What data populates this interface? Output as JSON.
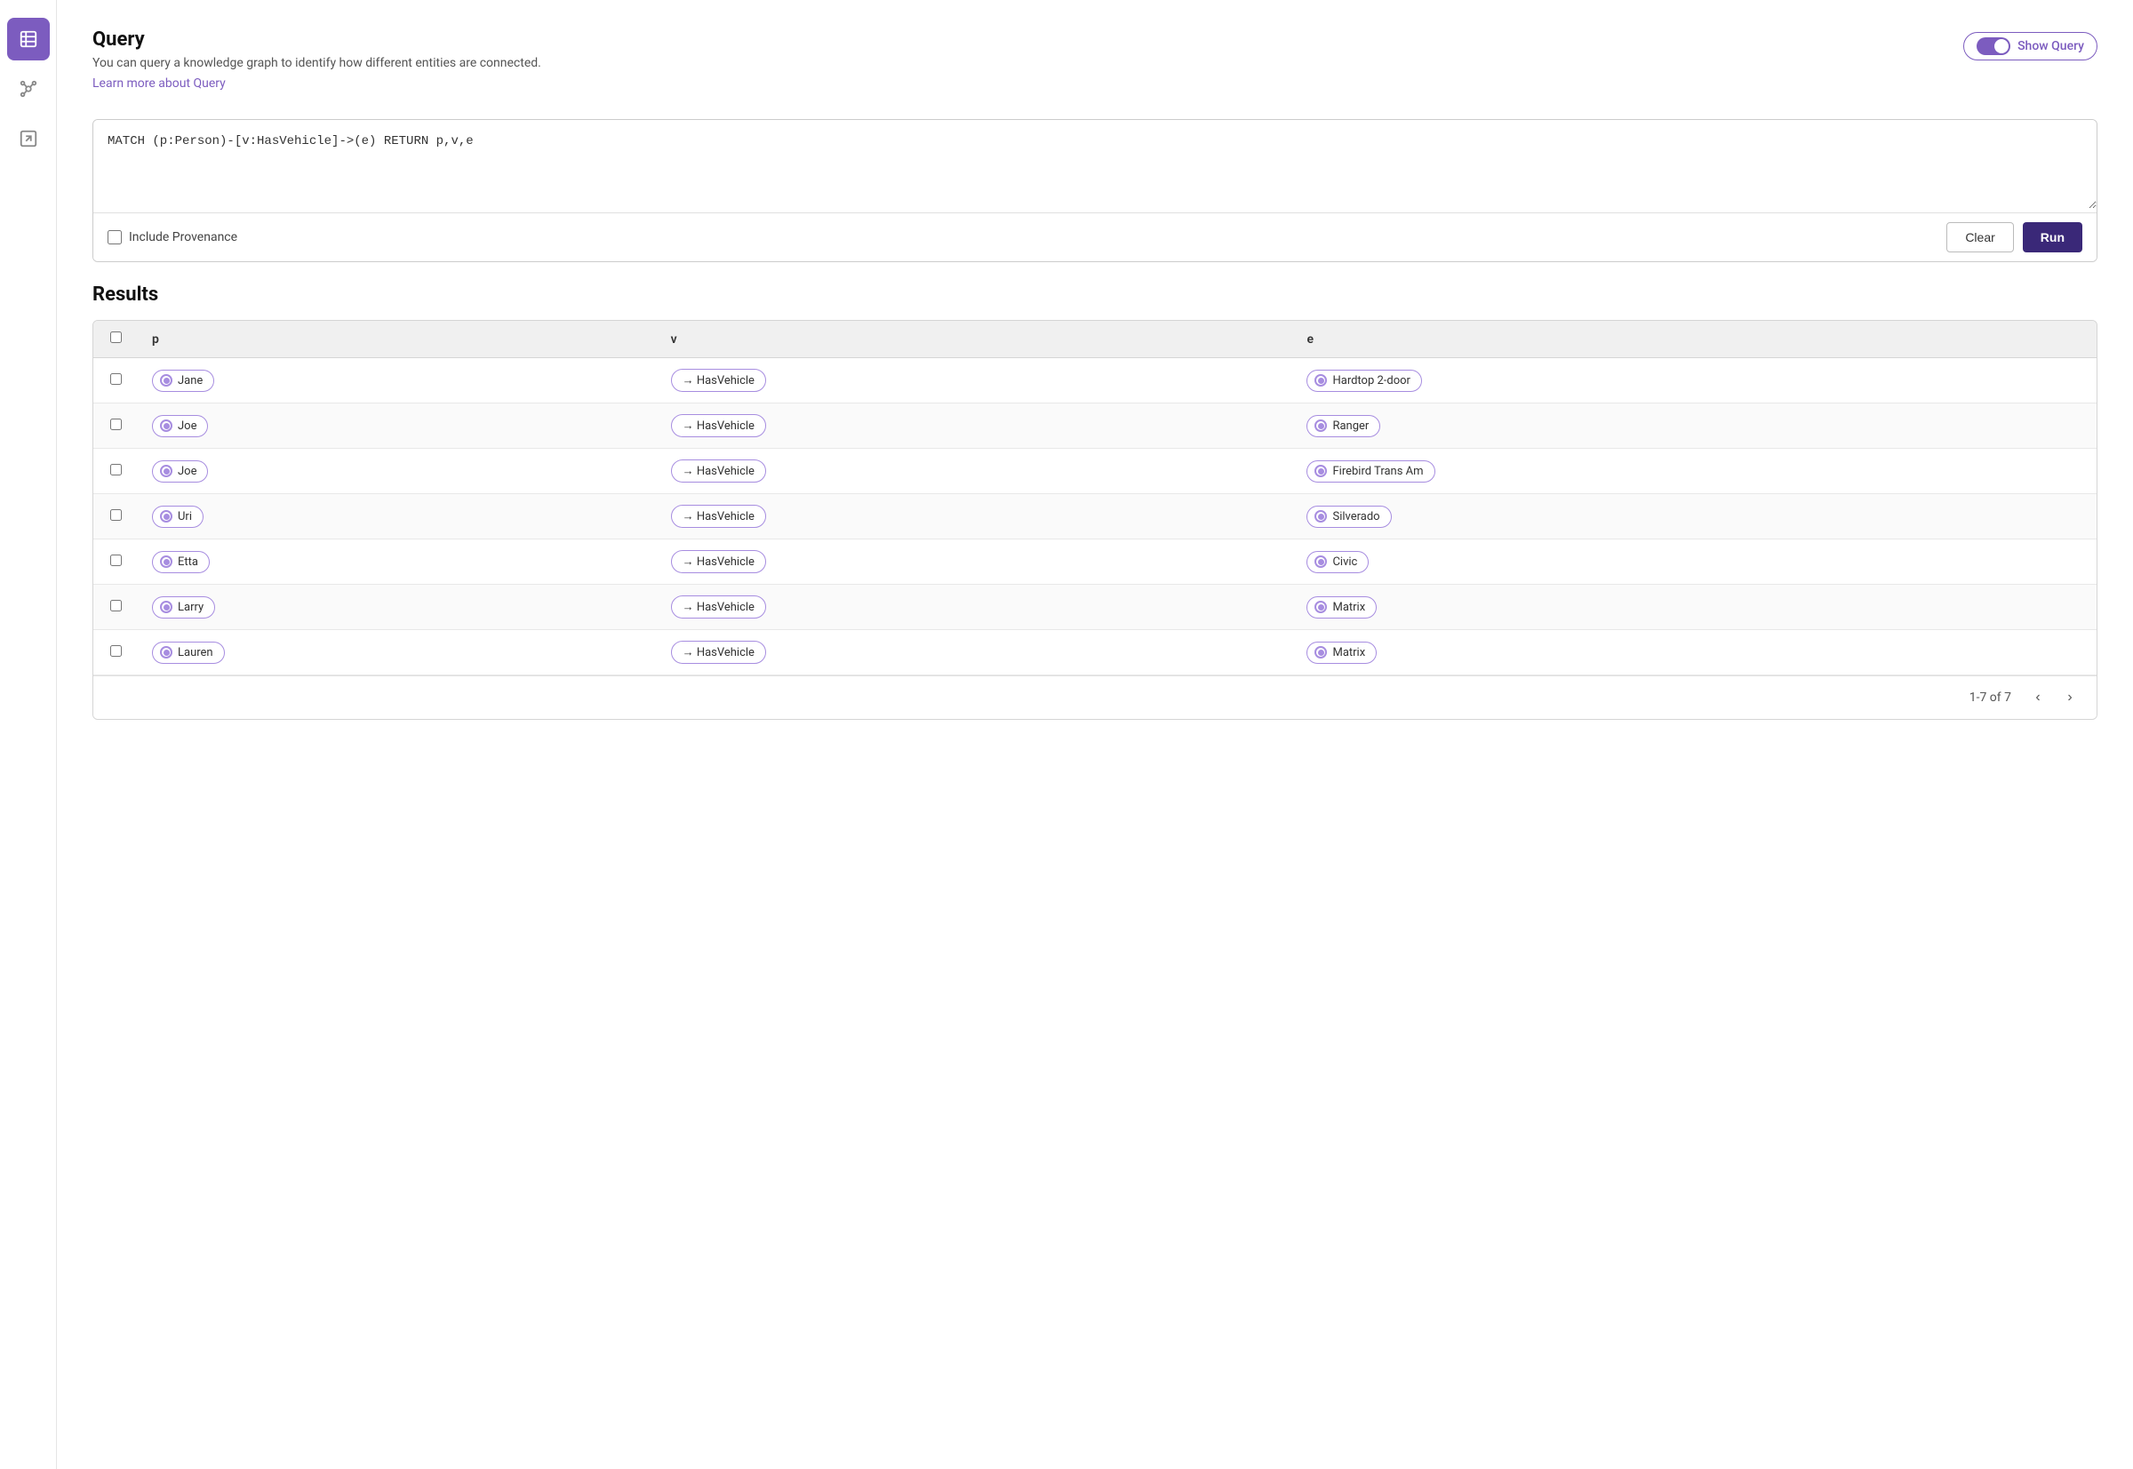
{
  "sidebar": {
    "items": [
      {
        "id": "table",
        "icon": "table-icon",
        "active": true
      },
      {
        "id": "graph",
        "icon": "graph-icon",
        "active": false
      },
      {
        "id": "export",
        "icon": "export-icon",
        "active": false
      }
    ]
  },
  "query": {
    "title": "Query",
    "description": "You can query a knowledge graph to identify how different entities are connected.",
    "learn_more_text": "Learn more about Query",
    "toggle_label": "Show Query",
    "query_text": "MATCH (p:Person)-[v:HasVehicle]->(e) RETURN p,v,e",
    "include_provenance_label": "Include Provenance",
    "clear_button": "Clear",
    "run_button": "Run"
  },
  "results": {
    "title": "Results",
    "columns": [
      {
        "id": "checkbox",
        "label": ""
      },
      {
        "id": "p",
        "label": "p"
      },
      {
        "id": "v",
        "label": "v"
      },
      {
        "id": "e",
        "label": "e"
      }
    ],
    "rows": [
      {
        "p": "Jane",
        "v": "→  HasVehicle",
        "e": "Hardtop 2-door"
      },
      {
        "p": "Joe",
        "v": "→  HasVehicle",
        "e": "Ranger"
      },
      {
        "p": "Joe",
        "v": "→  HasVehicle",
        "e": "Firebird Trans Am"
      },
      {
        "p": "Uri",
        "v": "→  HasVehicle",
        "e": "Silverado"
      },
      {
        "p": "Etta",
        "v": "→  HasVehicle",
        "e": "Civic"
      },
      {
        "p": "Larry",
        "v": "→  HasVehicle",
        "e": "Matrix"
      },
      {
        "p": "Lauren",
        "v": "→  HasVehicle",
        "e": "Matrix"
      }
    ],
    "pagination": {
      "range": "1-7 of 7"
    }
  }
}
